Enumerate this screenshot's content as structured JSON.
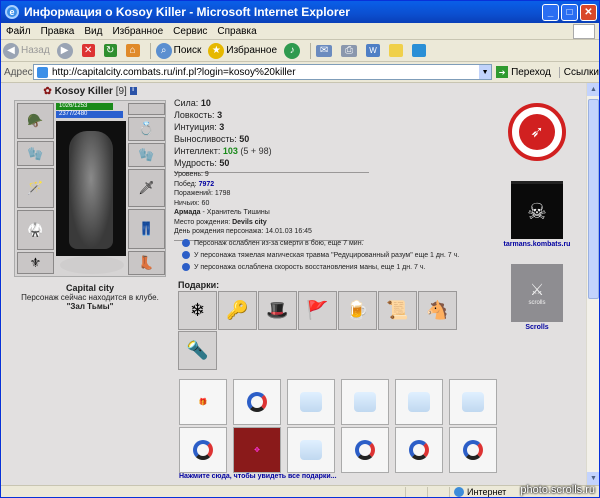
{
  "window": {
    "title": "Информация о Kosoy Killer - Microsoft Internet Explorer"
  },
  "menu": [
    "Файл",
    "Правка",
    "Вид",
    "Избранное",
    "Сервис",
    "Справка"
  ],
  "toolbar": {
    "back": "Назад",
    "search": "Поиск",
    "favorites": "Избранное"
  },
  "address": {
    "label": "Адрес:",
    "url": "http://capitalcity.combats.ru/inf.pl?login=kosoy%20killer",
    "go": "Переход",
    "links": "Ссылки"
  },
  "character": {
    "name": "Kosoy Killer",
    "level": "[9]",
    "hp_text": "1026/1253",
    "mana_text": "2377/2480",
    "hp_fraction": 0.82,
    "mana_fraction": 0.96,
    "city": "Capital city",
    "location_note": "Персонаж сейчас находится в клубе.",
    "room": "\"Зал Тьмы\""
  },
  "stats": [
    {
      "label": "Сила:",
      "value": "10"
    },
    {
      "label": "Ловкость:",
      "value": "3"
    },
    {
      "label": "Интуиция:",
      "value": "3"
    },
    {
      "label": "Выносливость:",
      "value": "50"
    },
    {
      "label": "Интеллект:",
      "value": "103",
      "extra": "(5 + 98)"
    },
    {
      "label": "Мудрость:",
      "value": "50"
    }
  ],
  "info": {
    "level": "Уровень: 9",
    "wins_label": "Побед:",
    "wins": "7972",
    "losses": "Поражений: 1798",
    "draws": "Ничьих: 60",
    "army_label": "Армада",
    "army_rest": " - Хранитель Тишины",
    "birthplace_label": "Место рождения:",
    "birthplace": "Devils city",
    "birthday": "День рождения персонажа: 14.01.03 16:45"
  },
  "effects": [
    "Персонаж ослаблен из-за смерти в бою, еще 7 мин.",
    "У персонажа тяжелая магическая травма \"Редуцированный разум\" еще 1 дн. 7 ч.",
    "У персонажа ослаблена скорость восстановления маны, еще 1 дн. 7 ч."
  ],
  "gifts": {
    "title": "Подарки:",
    "more_link": "Нажмите сюда, чтобы увидеть все подарки..."
  },
  "emblems": {
    "caption1": "tarmans.kombats.ru",
    "caption2": "Scrolls",
    "banner2_text": "scrolls"
  },
  "status": {
    "zone": "Интернет"
  },
  "watermark": "photo.scrolls.ru"
}
